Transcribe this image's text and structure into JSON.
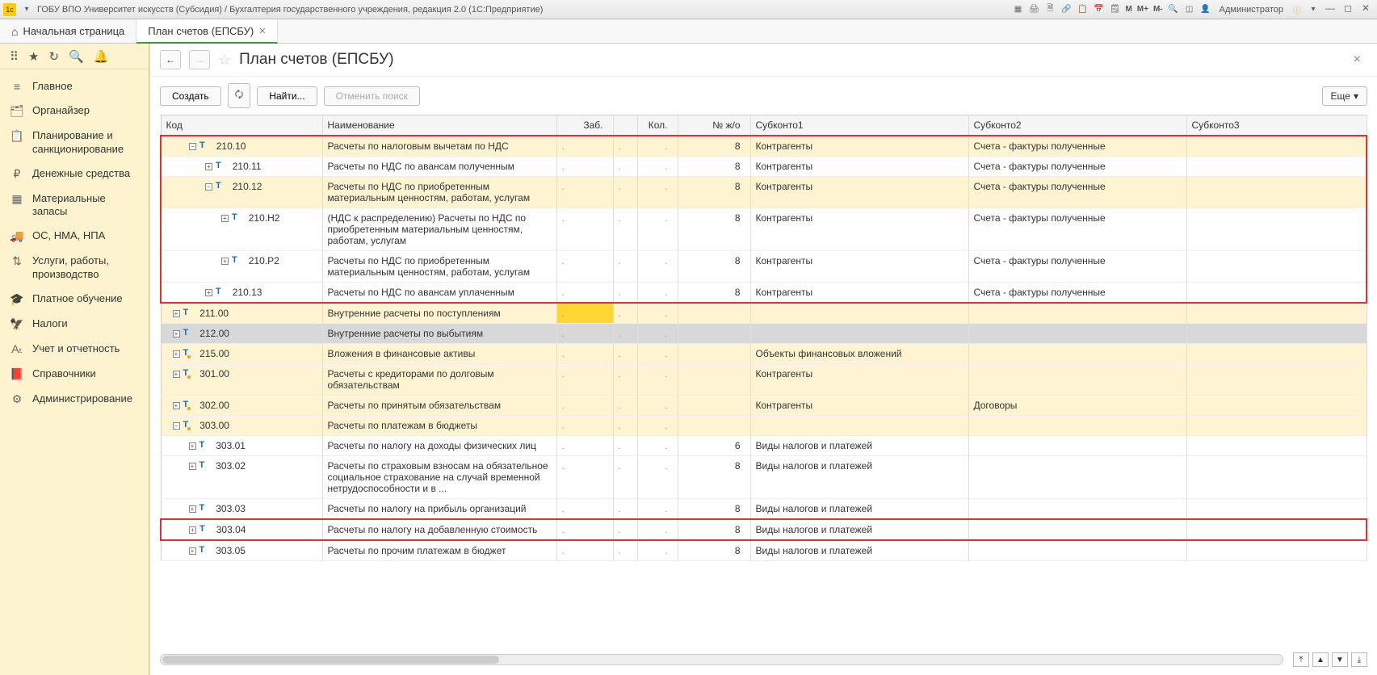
{
  "app": {
    "title": "ГОБУ ВПО Университет искусств (Субсидия) / Бухгалтерия государственного учреждения, редакция 2.0  (1С:Предприятие)",
    "user_label": "Администратор",
    "m_plus": "M+",
    "m_minus": "M-",
    "m": "M"
  },
  "tabs": {
    "home": "Начальная страница",
    "active": "План счетов (ЕПСБУ)"
  },
  "sidebar": {
    "items": [
      {
        "icon": "≡",
        "label": "Главное"
      },
      {
        "icon": "🗂",
        "label": "Органайзер"
      },
      {
        "icon": "📋",
        "label": "Планирование и санкционирование"
      },
      {
        "icon": "₽",
        "label": "Денежные средства"
      },
      {
        "icon": "▦",
        "label": "Материальные запасы"
      },
      {
        "icon": "🚚",
        "label": "ОС, НМА, НПА"
      },
      {
        "icon": "⇅",
        "label": "Услуги, работы, производство"
      },
      {
        "icon": "🎓",
        "label": "Платное обучение"
      },
      {
        "icon": "🦅",
        "label": "Налоги"
      },
      {
        "icon": "Aₜ",
        "label": "Учет и отчетность"
      },
      {
        "icon": "📕",
        "label": "Справочники"
      },
      {
        "icon": "⚙",
        "label": "Администрирование"
      }
    ]
  },
  "page": {
    "title": "План счетов (ЕПСБУ)",
    "btn_create": "Создать",
    "btn_find": "Найти...",
    "btn_cancel_search": "Отменить поиск",
    "btn_more": "Еще"
  },
  "table": {
    "headers": {
      "code": "Код",
      "name": "Наименование",
      "zab": "Заб.",
      "kol": "Кол.",
      "nzo": "№ ж/о",
      "sub1": "Субконто1",
      "sub2": "Субконто2",
      "sub3": "Субконто3"
    },
    "rows": [
      {
        "indent": 1,
        "exp": "-",
        "dot": false,
        "code": "210.10",
        "name": "Расчеты по налоговым вычетам по НДС",
        "nzo": "8",
        "s1": "Контрагенты",
        "s2": "Счета - фактуры полученные",
        "s3": "",
        "cls": "hl red-top red-box"
      },
      {
        "indent": 2,
        "exp": "+",
        "dot": false,
        "code": "210.11",
        "name": "Расчеты по НДС по авансам полученным",
        "nzo": "8",
        "s1": "Контрагенты",
        "s2": "Счета - фактуры полученные",
        "s3": "",
        "cls": "red-box"
      },
      {
        "indent": 2,
        "exp": "-",
        "dot": false,
        "code": "210.12",
        "name": "Расчеты по НДС по приобретенным материальным ценностям, работам, услугам",
        "nzo": "8",
        "s1": "Контрагенты",
        "s2": "Счета - фактуры полученные",
        "s3": "",
        "cls": "hl red-box"
      },
      {
        "indent": 3,
        "exp": "+",
        "dot": false,
        "code": "210.Н2",
        "name": "(НДС к распределению) Расчеты по НДС по приобретенным материальным ценностям, работам, услугам",
        "nzo": "8",
        "s1": "Контрагенты",
        "s2": "Счета - фактуры полученные",
        "s3": "",
        "cls": "red-box"
      },
      {
        "indent": 3,
        "exp": "+",
        "dot": false,
        "code": "210.Р2",
        "name": "Расчеты по НДС по приобретенным материальным ценностям, работам, услугам",
        "nzo": "8",
        "s1": "Контрагенты",
        "s2": "Счета - фактуры полученные",
        "s3": "",
        "cls": "red-box"
      },
      {
        "indent": 2,
        "exp": "+",
        "dot": false,
        "code": "210.13",
        "name": "Расчеты по НДС по авансам уплаченным",
        "nzo": "8",
        "s1": "Контрагенты",
        "s2": "Счета - фактуры полученные",
        "s3": "",
        "cls": "red-bottom red-box"
      },
      {
        "indent": 0,
        "exp": "+",
        "dot": false,
        "code": "211.00",
        "name": "Внутренние расчеты по поступлениям",
        "nzo": "",
        "s1": "",
        "s2": "",
        "s3": "",
        "cls": "hl hl-gold"
      },
      {
        "indent": 0,
        "exp": "+",
        "dot": false,
        "code": "212.00",
        "name": "Внутренние расчеты по выбытиям",
        "nzo": "",
        "s1": "",
        "s2": "",
        "s3": "",
        "cls": "grey"
      },
      {
        "indent": 0,
        "exp": "+",
        "dot": true,
        "code": "215.00",
        "name": "Вложения в финансовые активы",
        "nzo": "",
        "s1": "Объекты финансовых вложений",
        "s2": "",
        "s3": "",
        "cls": "hl"
      },
      {
        "indent": 0,
        "exp": "+",
        "dot": true,
        "code": "301.00",
        "name": "Расчеты с кредиторами по долговым обязательствам",
        "nzo": "",
        "s1": "Контрагенты",
        "s2": "",
        "s3": "",
        "cls": "hl"
      },
      {
        "indent": 0,
        "exp": "+",
        "dot": true,
        "code": "302.00",
        "name": "Расчеты по принятым обязательствам",
        "nzo": "",
        "s1": "Контрагенты",
        "s2": "Договоры",
        "s3": "",
        "cls": "hl"
      },
      {
        "indent": 0,
        "exp": "-",
        "dot": true,
        "code": "303.00",
        "name": "Расчеты по платежам в бюджеты",
        "nzo": "",
        "s1": "",
        "s2": "",
        "s3": "",
        "cls": "hl"
      },
      {
        "indent": 1,
        "exp": "+",
        "dot": false,
        "code": "303.01",
        "name": "Расчеты по налогу на доходы физических лиц",
        "nzo": "6",
        "s1": "Виды налогов и платежей",
        "s2": "",
        "s3": "",
        "cls": ""
      },
      {
        "indent": 1,
        "exp": "+",
        "dot": false,
        "code": "303.02",
        "name": "Расчеты по страховым взносам на обязательное социальное страхование на случай временной нетрудоспособности и в ...",
        "nzo": "8",
        "s1": "Виды налогов и платежей",
        "s2": "",
        "s3": "",
        "cls": ""
      },
      {
        "indent": 1,
        "exp": "+",
        "dot": false,
        "code": "303.03",
        "name": "Расчеты по налогу на прибыль организаций",
        "nzo": "8",
        "s1": "Виды налогов и платежей",
        "s2": "",
        "s3": "",
        "cls": ""
      },
      {
        "indent": 1,
        "exp": "+",
        "dot": false,
        "code": "303.04",
        "name": "Расчеты по налогу на добавленную стоимость",
        "nzo": "8",
        "s1": "Виды налогов и платежей",
        "s2": "",
        "s3": "",
        "cls": "red-top red-bottom red-box"
      },
      {
        "indent": 1,
        "exp": "+",
        "dot": false,
        "code": "303.05",
        "name": "Расчеты по прочим платежам в бюджет",
        "nzo": "8",
        "s1": "Виды налогов и платежей",
        "s2": "",
        "s3": "",
        "cls": ""
      }
    ]
  }
}
